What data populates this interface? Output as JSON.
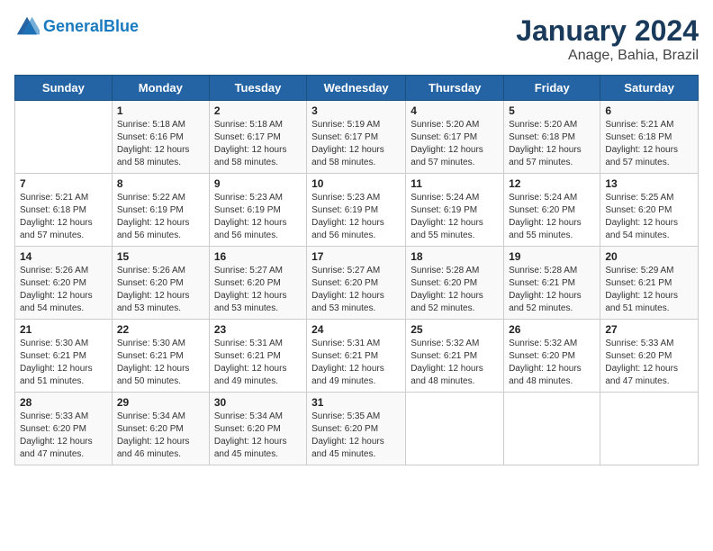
{
  "logo": {
    "line1": "General",
    "line2": "Blue"
  },
  "title": "January 2024",
  "subtitle": "Anage, Bahia, Brazil",
  "days_of_week": [
    "Sunday",
    "Monday",
    "Tuesday",
    "Wednesday",
    "Thursday",
    "Friday",
    "Saturday"
  ],
  "weeks": [
    [
      {
        "day": "",
        "info": ""
      },
      {
        "day": "1",
        "info": "Sunrise: 5:18 AM\nSunset: 6:16 PM\nDaylight: 12 hours\nand 58 minutes."
      },
      {
        "day": "2",
        "info": "Sunrise: 5:18 AM\nSunset: 6:17 PM\nDaylight: 12 hours\nand 58 minutes."
      },
      {
        "day": "3",
        "info": "Sunrise: 5:19 AM\nSunset: 6:17 PM\nDaylight: 12 hours\nand 58 minutes."
      },
      {
        "day": "4",
        "info": "Sunrise: 5:20 AM\nSunset: 6:17 PM\nDaylight: 12 hours\nand 57 minutes."
      },
      {
        "day": "5",
        "info": "Sunrise: 5:20 AM\nSunset: 6:18 PM\nDaylight: 12 hours\nand 57 minutes."
      },
      {
        "day": "6",
        "info": "Sunrise: 5:21 AM\nSunset: 6:18 PM\nDaylight: 12 hours\nand 57 minutes."
      }
    ],
    [
      {
        "day": "7",
        "info": "Sunrise: 5:21 AM\nSunset: 6:18 PM\nDaylight: 12 hours\nand 57 minutes."
      },
      {
        "day": "8",
        "info": "Sunrise: 5:22 AM\nSunset: 6:19 PM\nDaylight: 12 hours\nand 56 minutes."
      },
      {
        "day": "9",
        "info": "Sunrise: 5:23 AM\nSunset: 6:19 PM\nDaylight: 12 hours\nand 56 minutes."
      },
      {
        "day": "10",
        "info": "Sunrise: 5:23 AM\nSunset: 6:19 PM\nDaylight: 12 hours\nand 56 minutes."
      },
      {
        "day": "11",
        "info": "Sunrise: 5:24 AM\nSunset: 6:19 PM\nDaylight: 12 hours\nand 55 minutes."
      },
      {
        "day": "12",
        "info": "Sunrise: 5:24 AM\nSunset: 6:20 PM\nDaylight: 12 hours\nand 55 minutes."
      },
      {
        "day": "13",
        "info": "Sunrise: 5:25 AM\nSunset: 6:20 PM\nDaylight: 12 hours\nand 54 minutes."
      }
    ],
    [
      {
        "day": "14",
        "info": "Sunrise: 5:26 AM\nSunset: 6:20 PM\nDaylight: 12 hours\nand 54 minutes."
      },
      {
        "day": "15",
        "info": "Sunrise: 5:26 AM\nSunset: 6:20 PM\nDaylight: 12 hours\nand 53 minutes."
      },
      {
        "day": "16",
        "info": "Sunrise: 5:27 AM\nSunset: 6:20 PM\nDaylight: 12 hours\nand 53 minutes."
      },
      {
        "day": "17",
        "info": "Sunrise: 5:27 AM\nSunset: 6:20 PM\nDaylight: 12 hours\nand 53 minutes."
      },
      {
        "day": "18",
        "info": "Sunrise: 5:28 AM\nSunset: 6:20 PM\nDaylight: 12 hours\nand 52 minutes."
      },
      {
        "day": "19",
        "info": "Sunrise: 5:28 AM\nSunset: 6:21 PM\nDaylight: 12 hours\nand 52 minutes."
      },
      {
        "day": "20",
        "info": "Sunrise: 5:29 AM\nSunset: 6:21 PM\nDaylight: 12 hours\nand 51 minutes."
      }
    ],
    [
      {
        "day": "21",
        "info": "Sunrise: 5:30 AM\nSunset: 6:21 PM\nDaylight: 12 hours\nand 51 minutes."
      },
      {
        "day": "22",
        "info": "Sunrise: 5:30 AM\nSunset: 6:21 PM\nDaylight: 12 hours\nand 50 minutes."
      },
      {
        "day": "23",
        "info": "Sunrise: 5:31 AM\nSunset: 6:21 PM\nDaylight: 12 hours\nand 49 minutes."
      },
      {
        "day": "24",
        "info": "Sunrise: 5:31 AM\nSunset: 6:21 PM\nDaylight: 12 hours\nand 49 minutes."
      },
      {
        "day": "25",
        "info": "Sunrise: 5:32 AM\nSunset: 6:21 PM\nDaylight: 12 hours\nand 48 minutes."
      },
      {
        "day": "26",
        "info": "Sunrise: 5:32 AM\nSunset: 6:20 PM\nDaylight: 12 hours\nand 48 minutes."
      },
      {
        "day": "27",
        "info": "Sunrise: 5:33 AM\nSunset: 6:20 PM\nDaylight: 12 hours\nand 47 minutes."
      }
    ],
    [
      {
        "day": "28",
        "info": "Sunrise: 5:33 AM\nSunset: 6:20 PM\nDaylight: 12 hours\nand 47 minutes."
      },
      {
        "day": "29",
        "info": "Sunrise: 5:34 AM\nSunset: 6:20 PM\nDaylight: 12 hours\nand 46 minutes."
      },
      {
        "day": "30",
        "info": "Sunrise: 5:34 AM\nSunset: 6:20 PM\nDaylight: 12 hours\nand 45 minutes."
      },
      {
        "day": "31",
        "info": "Sunrise: 5:35 AM\nSunset: 6:20 PM\nDaylight: 12 hours\nand 45 minutes."
      },
      {
        "day": "",
        "info": ""
      },
      {
        "day": "",
        "info": ""
      },
      {
        "day": "",
        "info": ""
      }
    ]
  ]
}
